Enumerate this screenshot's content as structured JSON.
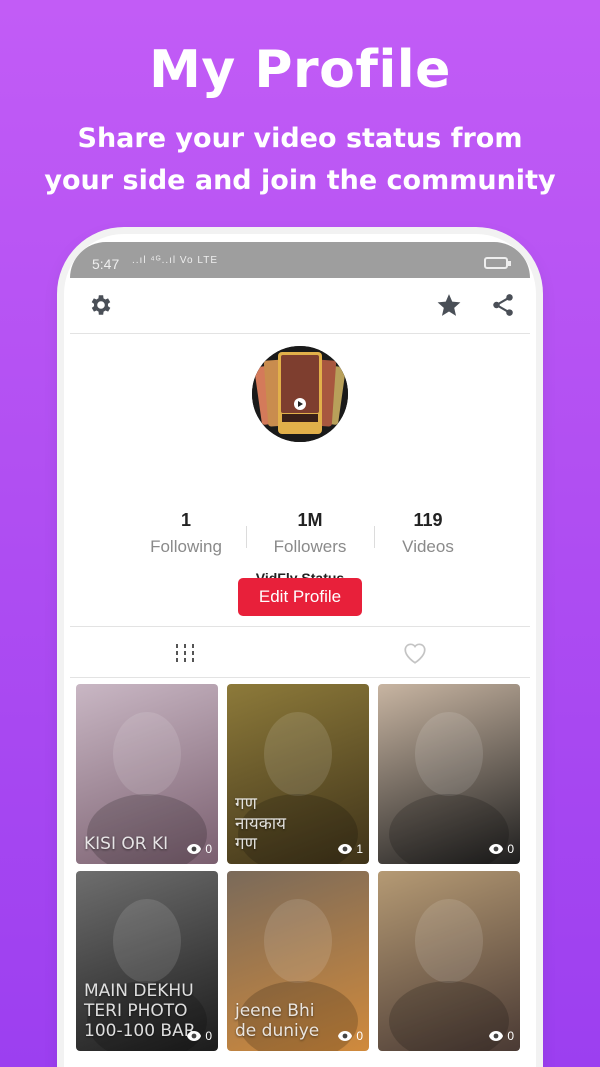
{
  "promo": {
    "title": "My Profile",
    "subtitle": "Share your video status from your side and join the community"
  },
  "status_bar": {
    "time": "5:47",
    "signal": "..ıl ⁴ᴳ..ıl Vo LTE"
  },
  "app_bar": {
    "left_icon": "gear-icon",
    "right_icons": [
      "star-icon",
      "share-icon"
    ]
  },
  "profile": {
    "username": "VidFly Status",
    "stats": [
      {
        "value": "1",
        "label": "Following"
      },
      {
        "value": "1M",
        "label": "Followers"
      },
      {
        "value": "119",
        "label": "Videos"
      }
    ],
    "edit_button": "Edit Profile"
  },
  "tabs": [
    {
      "icon": "grid-icon",
      "active": true
    },
    {
      "icon": "heart-icon",
      "active": false
    }
  ],
  "videos": [
    {
      "caption": "KISI OR KI",
      "views": "0",
      "color_a": "#c9b7c4",
      "color_b": "#7a5f6f"
    },
    {
      "caption": "गण\nनायकाय\nगण",
      "views": "1",
      "color_a": "#8d7a3a",
      "color_b": "#3f3319"
    },
    {
      "caption": "",
      "views": "0",
      "color_a": "#c8b5a2",
      "color_b": "#1e1e1e"
    },
    {
      "caption": "MAIN   DEKHU\nTERI  PHOTO\n100-100   BAR",
      "views": "0",
      "color_a": "#6e6e6e",
      "color_b": "#1c1c1c"
    },
    {
      "caption": "jeene Bhi\nde duniye",
      "views": "0",
      "color_a": "#7a6a5a",
      "color_b": "#d08a3c"
    },
    {
      "caption": "",
      "views": "0",
      "color_a": "#b59a74",
      "color_b": "#4a3a34"
    }
  ]
}
